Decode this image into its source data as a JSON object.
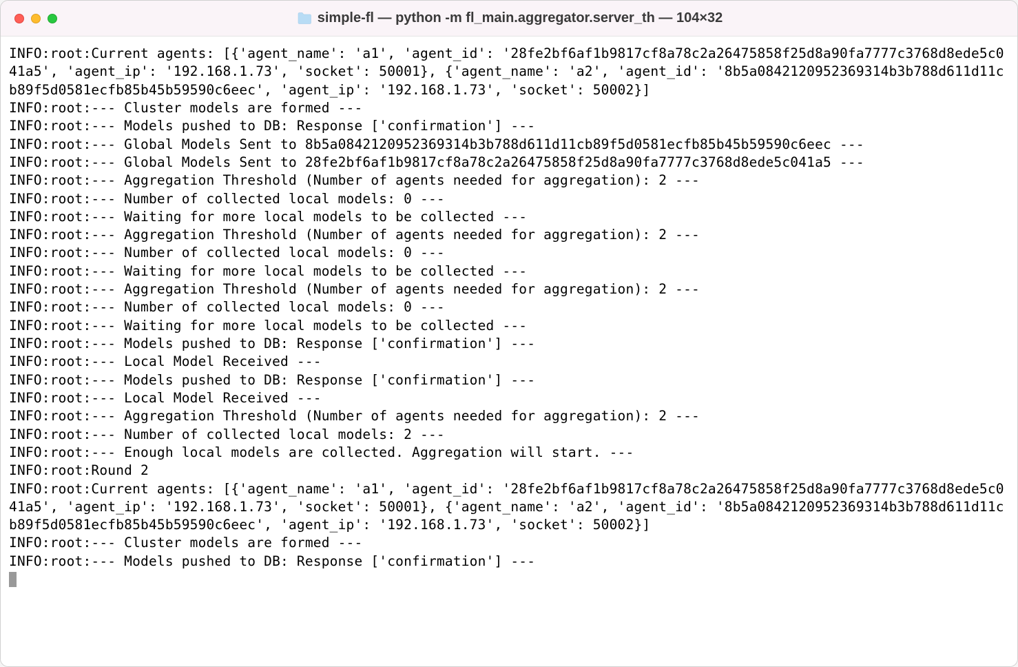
{
  "window": {
    "title": "simple-fl — python -m fl_main.aggregator.server_th — 104×32"
  },
  "terminal": {
    "lines": [
      "INFO:root:Current agents: [{'agent_name': 'a1', 'agent_id': '28fe2bf6af1b9817cf8a78c2a26475858f25d8a90fa7777c3768d8ede5c041a5', 'agent_ip': '192.168.1.73', 'socket': 50001}, {'agent_name': 'a2', 'agent_id': '8b5a0842120952369314b3b788d611d11cb89f5d0581ecfb85b45b59590c6eec', 'agent_ip': '192.168.1.73', 'socket': 50002}]",
      "INFO:root:--- Cluster models are formed ---",
      "INFO:root:--- Models pushed to DB: Response ['confirmation'] ---",
      "INFO:root:--- Global Models Sent to 8b5a0842120952369314b3b788d611d11cb89f5d0581ecfb85b45b59590c6eec ---",
      "INFO:root:--- Global Models Sent to 28fe2bf6af1b9817cf8a78c2a26475858f25d8a90fa7777c3768d8ede5c041a5 ---",
      "INFO:root:--- Aggregation Threshold (Number of agents needed for aggregation): 2 ---",
      "INFO:root:--- Number of collected local models: 0 ---",
      "INFO:root:--- Waiting for more local models to be collected ---",
      "INFO:root:--- Aggregation Threshold (Number of agents needed for aggregation): 2 ---",
      "INFO:root:--- Number of collected local models: 0 ---",
      "INFO:root:--- Waiting for more local models to be collected ---",
      "INFO:root:--- Aggregation Threshold (Number of agents needed for aggregation): 2 ---",
      "INFO:root:--- Number of collected local models: 0 ---",
      "INFO:root:--- Waiting for more local models to be collected ---",
      "INFO:root:--- Models pushed to DB: Response ['confirmation'] ---",
      "INFO:root:--- Local Model Received ---",
      "INFO:root:--- Models pushed to DB: Response ['confirmation'] ---",
      "INFO:root:--- Local Model Received ---",
      "INFO:root:--- Aggregation Threshold (Number of agents needed for aggregation): 2 ---",
      "INFO:root:--- Number of collected local models: 2 ---",
      "INFO:root:--- Enough local models are collected. Aggregation will start. ---",
      "INFO:root:Round 2",
      "INFO:root:Current agents: [{'agent_name': 'a1', 'agent_id': '28fe2bf6af1b9817cf8a78c2a26475858f25d8a90fa7777c3768d8ede5c041a5', 'agent_ip': '192.168.1.73', 'socket': 50001}, {'agent_name': 'a2', 'agent_id': '8b5a0842120952369314b3b788d611d11cb89f5d0581ecfb85b45b59590c6eec', 'agent_ip': '192.168.1.73', 'socket': 50002}]",
      "INFO:root:--- Cluster models are formed ---",
      "INFO:root:--- Models pushed to DB: Response ['confirmation'] ---"
    ]
  }
}
